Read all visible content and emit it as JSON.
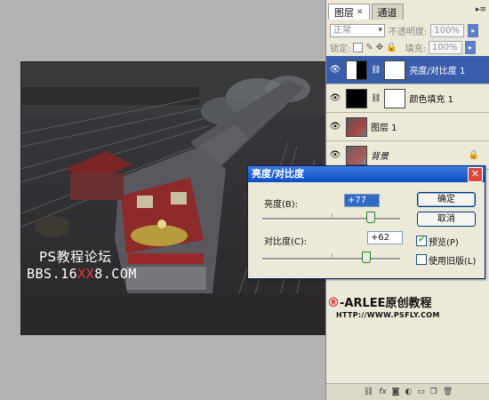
{
  "watermark": {
    "forum": "PS教程论坛",
    "site_prefix": "BBS.16",
    "site_red": "XX",
    "site_suffix": "8.COM"
  },
  "layers_panel": {
    "tabs": [
      {
        "label": "图层",
        "active": true
      },
      {
        "label": "通道",
        "active": false
      }
    ],
    "blend_mode": "正常",
    "opacity_label": "不透明度:",
    "opacity_value": "100%",
    "lock_label": "锁定:",
    "fill_label": "填充:",
    "fill_value": "100%",
    "layers": [
      {
        "name": "亮度/对比度 1",
        "type": "adjustment",
        "active": true,
        "locked": false
      },
      {
        "name": "颜色填充 1",
        "type": "fill",
        "active": false,
        "locked": false
      },
      {
        "name": "图层 1",
        "type": "pixel",
        "active": false,
        "locked": false
      },
      {
        "name": "背景",
        "type": "background",
        "active": false,
        "locked": true
      }
    ],
    "footer_icons": [
      "link-icon",
      "fx-icon",
      "mask-icon",
      "adjustment-icon",
      "group-icon",
      "new-layer-icon",
      "trash-icon"
    ]
  },
  "dialog": {
    "title": "亮度/对比度",
    "brightness_label": "亮度(B):",
    "brightness_value": "+77",
    "contrast_label": "对比度(C):",
    "contrast_value": "+62",
    "ok_label": "确定",
    "cancel_label": "取消",
    "preview_label": "预览(P)",
    "preview_checked": true,
    "legacy_label": "使用旧版(L)",
    "legacy_checked": false,
    "brightness_slider": 0.78,
    "contrast_slider": 0.75
  },
  "brand": {
    "symbol": "®",
    "name": "-ARLEE原创教程",
    "url": "HTTP://WWW.PSFLY.COM"
  }
}
